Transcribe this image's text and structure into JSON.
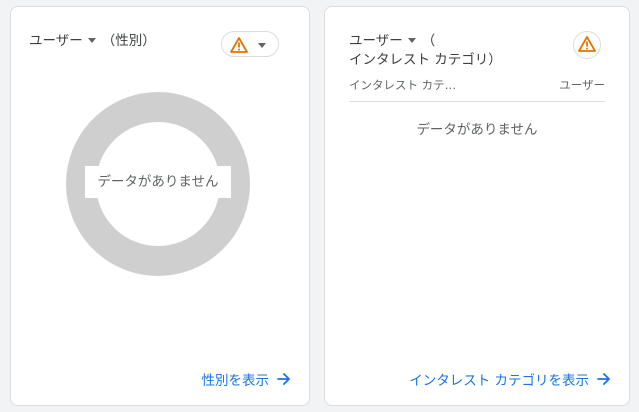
{
  "cards": {
    "gender": {
      "title_dim": "ユーザー",
      "title_rest": "（性別）",
      "no_data": "データがありません",
      "footer_link": "性別を表示"
    },
    "interest": {
      "title_dim": "ユーザー",
      "title_rest_line1": "（",
      "title_line2": "インタレスト カテゴリ）",
      "col_category": "インタレスト カテ…",
      "col_users": "ユーザー",
      "no_data": "データがありません",
      "footer_link": "インタレスト カテゴリを表示"
    }
  },
  "colors": {
    "warning": "#e37400",
    "link": "#1a73e8",
    "donut_ring": "#cfcfcf"
  },
  "icons": [
    "warning-icon",
    "arrow-right-icon",
    "chevron-down-icon"
  ]
}
